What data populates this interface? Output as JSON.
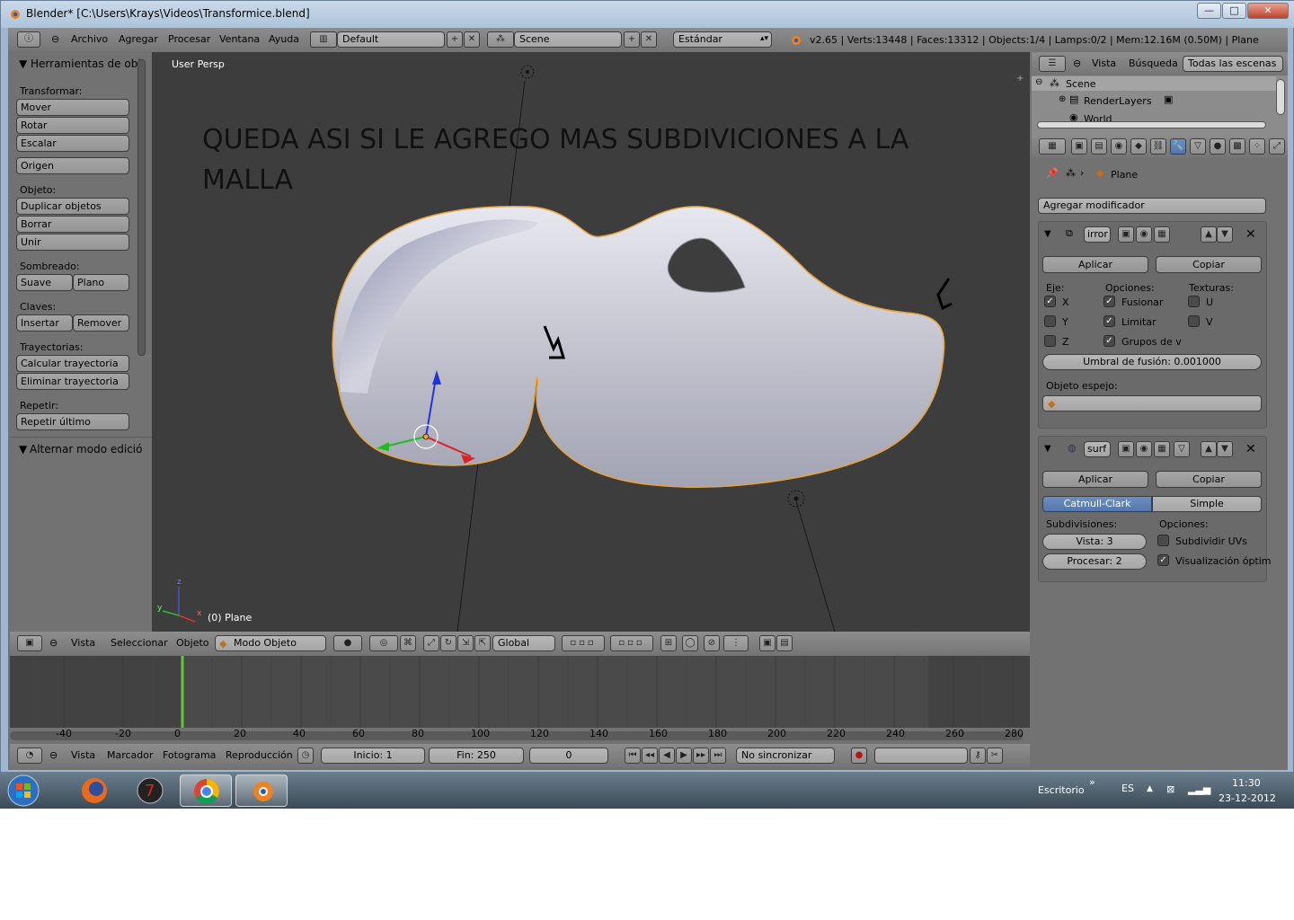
{
  "window": {
    "title": "Blender* [C:\\Users\\Krays\\Videos\\Transformice.blend]",
    "controls": {
      "minimize": "—",
      "maximize": "□",
      "close": "✕"
    }
  },
  "info_header": {
    "menus": [
      "Archivo",
      "Agregar",
      "Procesar",
      "Ventana",
      "Ayuda"
    ],
    "screen_layout": "Default",
    "scene": "Scene",
    "render_engine": "Estándar",
    "stats": "v2.65 | Verts:13448 | Faces:13312 | Objects:1/4 | Lamps:0/2 | Mem:12.16M (0.50M) | Plane"
  },
  "toolshelf": {
    "title": "Herramientas de obj",
    "sections": [
      {
        "label": "Transformar:",
        "buttons": [
          "Mover",
          "Rotar",
          "Escalar"
        ]
      },
      {
        "label": "",
        "buttons": [
          "Origen"
        ]
      },
      {
        "label": "Objeto:",
        "buttons": [
          "Duplicar objetos",
          "Borrar",
          "Unir"
        ]
      },
      {
        "label": "Sombreado:",
        "pair": [
          "Suave",
          "Plano"
        ]
      },
      {
        "label": "Claves:",
        "pair": [
          "Insertar",
          "Remover"
        ]
      },
      {
        "label": "Trayectorias:",
        "buttons": [
          "Calcular trayectoria",
          "Eliminar trayectoria"
        ]
      },
      {
        "label": "Repetir:",
        "buttons": [
          "Repetir último"
        ]
      }
    ],
    "panel2": "Alternar modo edició"
  },
  "viewport": {
    "view_label": "User Persp",
    "annotation": "QUEDA ASI SI LE AGREGO MAS SUBDIVICIONES A LA MALLA",
    "object_label": "(0) Plane",
    "axis_labels": {
      "x": "x",
      "y": "y",
      "z": "z"
    }
  },
  "viewport_header": {
    "menus": [
      "Vista",
      "Seleccionar",
      "Objeto"
    ],
    "mode": "Modo Objeto",
    "orientation": "Global"
  },
  "timeline": {
    "ruler": [
      "-40",
      "-20",
      "0",
      "20",
      "40",
      "60",
      "80",
      "100",
      "120",
      "140",
      "160",
      "180",
      "200",
      "220",
      "240",
      "260",
      "280"
    ],
    "current_frame_marker": 0,
    "menus": [
      "Vista",
      "Marcador",
      "Fotograma",
      "Reproducción"
    ],
    "start": "Inicio: 1",
    "end": "Fin: 250",
    "frame": "0",
    "sync": "No sincronizar"
  },
  "outliner": {
    "menus": [
      "Vista",
      "Búsqueda"
    ],
    "filter": "Todas las escenas",
    "items": [
      "Scene",
      "RenderLayers",
      "World"
    ]
  },
  "properties": {
    "breadcrumb": "Plane",
    "add_modifier": "Agregar modificador",
    "mirror": {
      "name": "irror",
      "apply": "Aplicar",
      "copy": "Copiar",
      "col_axis": "Eje:",
      "col_options": "Opciones:",
      "col_textures": "Texturas:",
      "axis": [
        {
          "label": "X",
          "checked": true
        },
        {
          "label": "Y",
          "checked": false
        },
        {
          "label": "Z",
          "checked": false
        }
      ],
      "options": [
        {
          "label": "Fusionar",
          "checked": true
        },
        {
          "label": "Limitar",
          "checked": true
        },
        {
          "label": "Grupos de v",
          "checked": true
        }
      ],
      "textures": [
        {
          "label": "U",
          "checked": false
        },
        {
          "label": "V",
          "checked": false
        }
      ],
      "merge_limit": "Umbral de fusión: 0.001000",
      "mirror_object_label": "Objeto espejo:"
    },
    "subsurf": {
      "name": "surf",
      "apply": "Aplicar",
      "copy": "Copiar",
      "tab_catmull": "Catmull-Clark",
      "tab_simple": "Simple",
      "subdiv_label": "Subdivisiones:",
      "options_label": "Opciones:",
      "view": "Vista: 3",
      "render": "Procesar: 2",
      "subdivide_uvs": {
        "label": "Subdividir UVs",
        "checked": false
      },
      "optimal_display": {
        "label": "Visualización óptim",
        "checked": true
      }
    }
  },
  "taskbar": {
    "desktop_label": "Escritorio",
    "chevron": "»",
    "language": "ES",
    "time": "11:30",
    "date": "23-12-2012",
    "apps": [
      "windows-start",
      "firefox",
      "app-7",
      "chrome",
      "blender"
    ]
  },
  "colors": {
    "viewport_bg": "#3d3d3d",
    "panel_bg": "#727272",
    "mesh_fill": "#bfc0ca",
    "selection_outline": "#e8a33a",
    "active_tab": "#5577ac",
    "frame_marker": "#5ec932"
  }
}
